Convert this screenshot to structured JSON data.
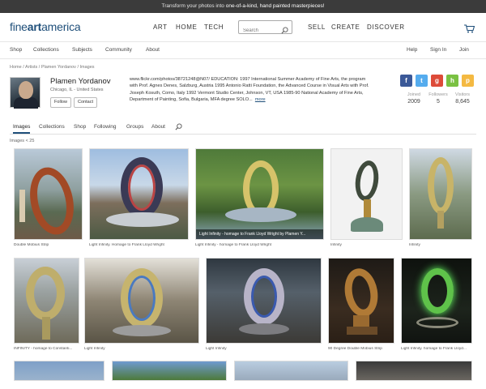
{
  "promo": {
    "before": "Transform your photos into ",
    "highlight": "one-of-a-kind, hand painted masterpieces!"
  },
  "logo": {
    "part1": "fine",
    "part2": "art",
    "part3": "america"
  },
  "main_nav": [
    "ART",
    "HOME",
    "TECH",
    "SELL",
    "CREATE",
    "DISCOVER"
  ],
  "search": {
    "placeholder": "Search"
  },
  "sub_nav": {
    "left": [
      "Shop",
      "Collections",
      "Subjects",
      "Community",
      "About"
    ],
    "right": [
      "Help",
      "Sign In",
      "Join"
    ]
  },
  "breadcrumb": "Home / Artists / Plamen Yordanov / Images",
  "profile": {
    "name": "Plamen Yordanov",
    "location": "Chicago, IL - United States",
    "follow": "Follow",
    "contact": "Contact",
    "bio": "www.flickr.com/photos/38721248@N07/ EDUCATION: 1997 International Summer Academy of Fine Arts, the program with Prof.   Agnes Denes, Salzburg, Austria 1995 Antonio Ratti Foundation, the Advanced Course in Visual Arts with Prof.   Joseph Kosuth, Como, Italy 1992 Vermont Studio Center, Johnson, VT, USA 1985-90 National Academy of Fine Arts, Department of Painting, Sofia, Bulgaria, MFA degree SOLO...",
    "more": "more",
    "stats": [
      {
        "label": "Joined",
        "value": "2009"
      },
      {
        "label": "Followers",
        "value": "5"
      },
      {
        "label": "Visitors",
        "value": "8,645"
      }
    ]
  },
  "social_colors": {
    "facebook": "#3b5998",
    "twitter": "#55acee",
    "google": "#dd4b39",
    "houzz": "#7ac142",
    "pinterest": "#f4b942"
  },
  "tabs": [
    "Images",
    "Collections",
    "Shop",
    "Following",
    "Groups",
    "About"
  ],
  "image_count": "Images < 25",
  "gallery": [
    {
      "caption": "Double Mobius Strip"
    },
    {
      "caption": "Light Infinity. Homage to Frank Lloyd Wright"
    },
    {
      "caption": "Light Infinity - homage to Frank Lloyd Wright",
      "overlay": "Light Infinity - homage to Frank Lloyd Wright by Plamen Y..."
    },
    {
      "caption": "Infinity"
    },
    {
      "caption": "Infinity"
    },
    {
      "caption": "INFINITY - homage to Constanti..."
    },
    {
      "caption": "Light Infinity"
    },
    {
      "caption": "Light Infinity"
    },
    {
      "caption": "90 Degree Double Mobius Strip"
    },
    {
      "caption": "Light Infinity. homage to Frank Lloyd..."
    }
  ],
  "accent": "#1f4f7a"
}
